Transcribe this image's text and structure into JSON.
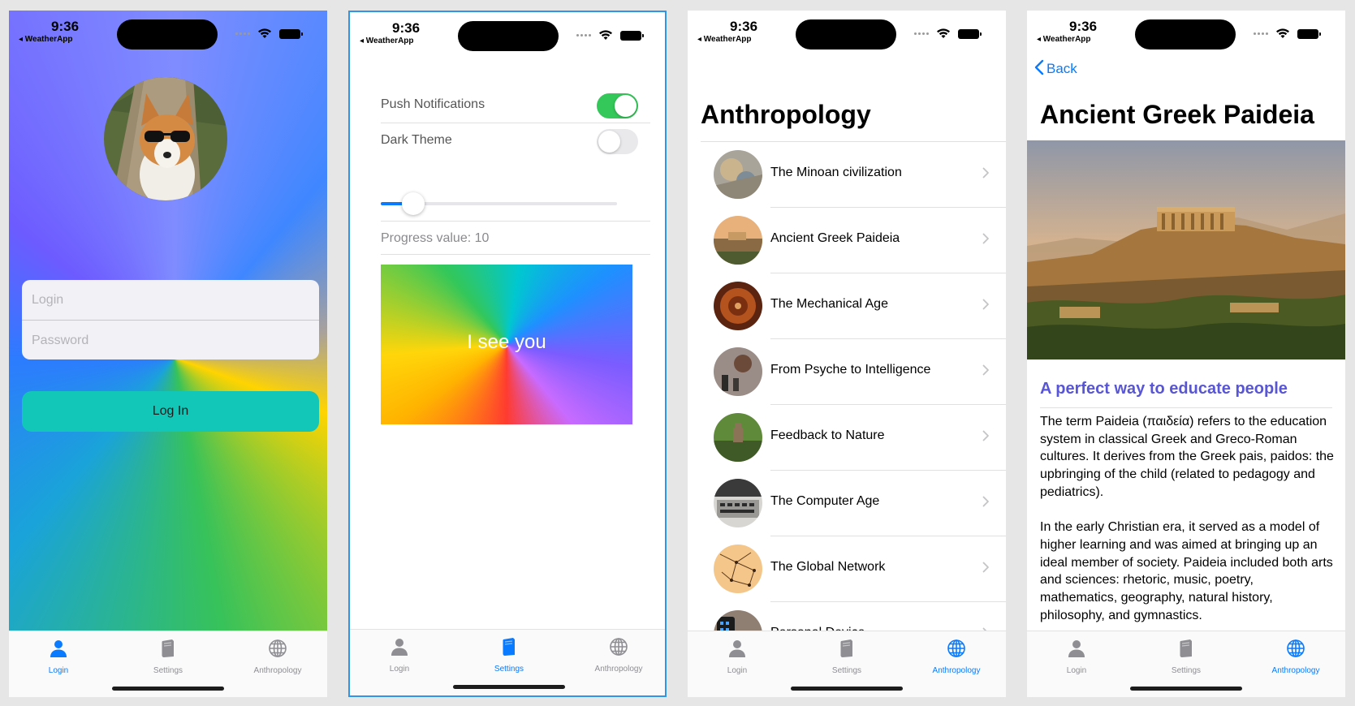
{
  "status": {
    "time": "9:36",
    "back_app": "◂ WeatherApp"
  },
  "tabs": {
    "login": "Login",
    "settings": "Settings",
    "anthropology": "Anthropology"
  },
  "login_screen": {
    "login_placeholder": "Login",
    "password_placeholder": "Password",
    "button_label": "Log In"
  },
  "settings_screen": {
    "push_notifications": {
      "label": "Push Notifications",
      "on": true
    },
    "dark_theme": {
      "label": "Dark Theme",
      "on": false
    },
    "slider_value": 10,
    "progress_text": "Progress value: 10",
    "card_text": "I see you"
  },
  "anthropology_screen": {
    "title": "Anthropology",
    "items": [
      {
        "label": "The Minoan civilization"
      },
      {
        "label": "Ancient Greek Paideia"
      },
      {
        "label": "The Mechanical Age"
      },
      {
        "label": "From Psyche to Intelligence"
      },
      {
        "label": "Feedback to Nature"
      },
      {
        "label": "The Computer Age"
      },
      {
        "label": "The Global Network"
      },
      {
        "label": "Personal Device"
      }
    ]
  },
  "detail_screen": {
    "back_label": "Back",
    "title": "Ancient Greek Paideia",
    "subtitle": "A perfect way to educate people",
    "paragraph1": "The term Paideia (παιδεία) refers to the education system in classical Greek and Greco-Roman cultures. It derives from the Greek pais, paidos: the upbringing of the child (related to pedagogy and pediatrics).",
    "paragraph2": "In the early Christian era, it served as a model of higher learning and was aimed at bringing up an ideal member of society. Paideia included both arts and sciences: rhetoric, music, poetry, mathematics, geography, natural history, philosophy, and gymnastics."
  },
  "colors": {
    "accent": "#0a7aff",
    "login_button": "#12c7b8",
    "toggle_on": "#34c759",
    "subtitle": "#5856d6",
    "selection_border": "#2f95e8"
  }
}
